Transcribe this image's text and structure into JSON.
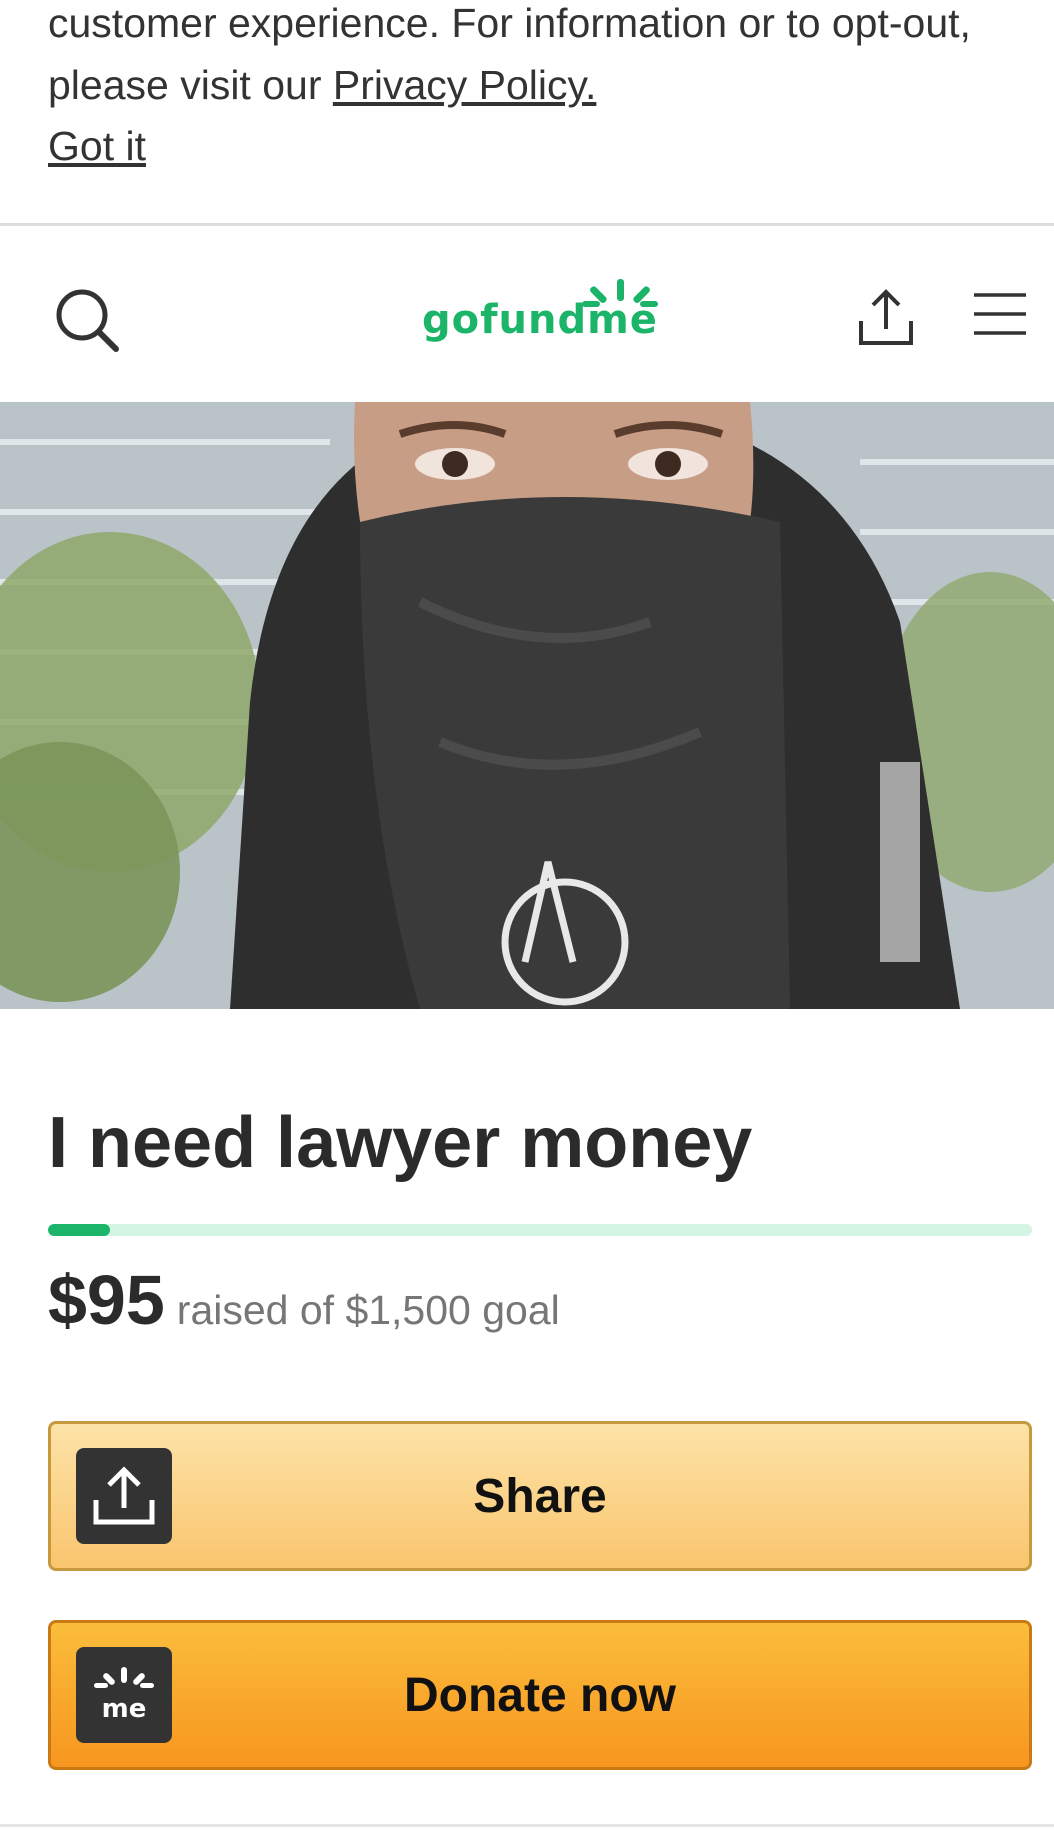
{
  "cookie_banner": {
    "text_before_link": "customer experience. For information or to opt-out, please visit our ",
    "privacy_link": "Privacy Policy.",
    "got_it": "Got it"
  },
  "header": {
    "logo_text": "gofundme",
    "icons": [
      "search-icon",
      "share-icon",
      "hamburger-menu-icon"
    ]
  },
  "campaign": {
    "title": "I need lawyer money",
    "raised": "$95",
    "goal_text": "raised of $1,500 goal",
    "progress_fraction": 0.063
  },
  "actions": {
    "share_label": "Share",
    "donate_label": "Donate now",
    "share_icon": "share-icon",
    "donate_icon": "gofundme-me-icon"
  },
  "colors": {
    "brand_green": "#1bb469",
    "progress_track": "#d4f4e4",
    "share_button": "#f9c56e",
    "donate_button": "#f7961f"
  }
}
